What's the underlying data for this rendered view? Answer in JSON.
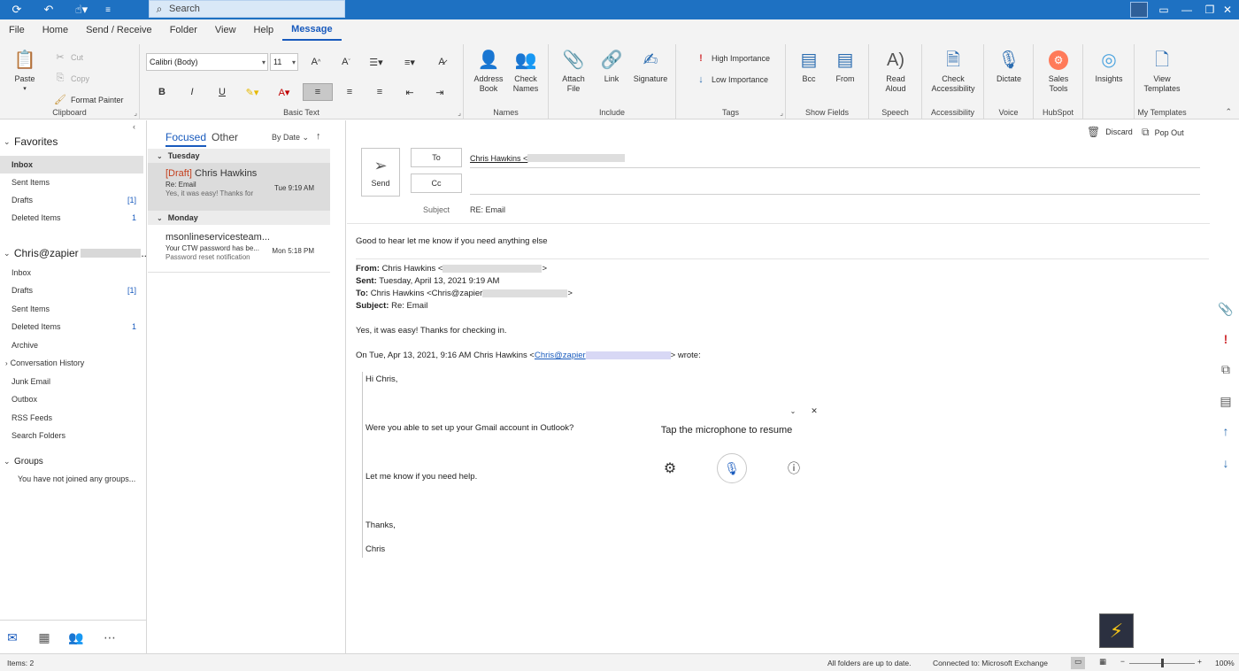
{
  "titlebar": {
    "search_placeholder": "Search"
  },
  "menu_tabs": [
    "File",
    "Home",
    "Send / Receive",
    "Folder",
    "View",
    "Help",
    "Message"
  ],
  "ribbon": {
    "clipboard": {
      "paste": "Paste",
      "cut": "Cut",
      "copy": "Copy",
      "format_painter": "Format Painter",
      "label": "Clipboard"
    },
    "basic_text": {
      "font": "Calibri (Body)",
      "size": "11",
      "label": "Basic Text"
    },
    "names": {
      "address_book": "Address Book",
      "check_names": "Check Names",
      "label": "Names"
    },
    "include": {
      "attach_file": "Attach File",
      "link": "Link",
      "signature": "Signature",
      "label": "Include"
    },
    "tags": {
      "high": "High Importance",
      "low": "Low Importance",
      "label": "Tags"
    },
    "show_fields": {
      "bcc": "Bcc",
      "from": "From",
      "label": "Show Fields"
    },
    "speech": {
      "read_aloud": "Read Aloud",
      "label": "Speech"
    },
    "accessibility": {
      "check": "Check Accessibility",
      "label": "Accessibility"
    },
    "voice": {
      "dictate": "Dictate",
      "label": "Voice"
    },
    "hubspot": {
      "sales_tools": "Sales Tools",
      "label": "HubSpot"
    },
    "insights": {
      "label": "Insights"
    },
    "templates": {
      "view": "View Templates",
      "label": "My Templates"
    }
  },
  "folders": {
    "favorites_header": "Favorites",
    "favorites": [
      {
        "label": "Inbox",
        "count": ""
      },
      {
        "label": "Sent Items",
        "count": ""
      },
      {
        "label": "Drafts",
        "count": "[1]"
      },
      {
        "label": "Deleted Items",
        "count": "1"
      }
    ],
    "account_header": "Chris@zapier",
    "account_suffix": "..",
    "account": [
      {
        "label": "Inbox",
        "count": ""
      },
      {
        "label": "Drafts",
        "count": "[1]"
      },
      {
        "label": "Sent Items",
        "count": ""
      },
      {
        "label": "Deleted Items",
        "count": "1"
      },
      {
        "label": "Archive",
        "count": ""
      },
      {
        "label": "Conversation History",
        "count": ""
      },
      {
        "label": "Junk Email",
        "count": ""
      },
      {
        "label": "Outbox",
        "count": ""
      },
      {
        "label": "RSS Feeds",
        "count": ""
      },
      {
        "label": "Search Folders",
        "count": ""
      }
    ],
    "groups_header": "Groups",
    "groups_empty": "You have not joined any groups..."
  },
  "message_list": {
    "tab_focused": "Focused",
    "tab_other": "Other",
    "sort": "By Date",
    "groups": [
      {
        "label": "Tuesday"
      },
      {
        "label": "Monday"
      }
    ],
    "items": [
      {
        "draft": "[Draft]",
        "from": "Chris Hawkins",
        "subject": "Re: Email",
        "preview": "Yes, it was easy! Thanks for",
        "time": "Tue 9:19 AM"
      },
      {
        "draft": "",
        "from": "msonlineservicesteam...",
        "subject": "Your CTW password has be...",
        "preview": "Password reset notification",
        "time": "Mon 5:18 PM"
      }
    ]
  },
  "reading": {
    "discard": "Discard",
    "pop_out": "Pop Out",
    "send": "Send",
    "to_label": "To",
    "cc_label": "Cc",
    "to_value": "Chris Hawkins <",
    "subject_label": "Subject",
    "subject_value": "RE: Email",
    "line1": "Good to hear let me know if you need anything else",
    "from_label": "From:",
    "from_value": "Chris Hawkins <",
    "sent_label": "Sent:",
    "sent_value": "Tuesday, April 13, 2021 9:19 AM",
    "to2_label": "To:",
    "to2_value": "Chris Hawkins <Chris@zapier",
    "subj2_label": "Subject:",
    "subj2_value": "Re: Email",
    "reply": "Yes, it was easy! Thanks for checking in.",
    "wrote_prefix": "On Tue, Apr 13, 2021, 9:16 AM Chris Hawkins <",
    "wrote_link": "Chris@zapier",
    "wrote_suffix": "> wrote:",
    "q1": "Hi Chris,",
    "q2": "Were you able to set up your Gmail account in Outlook?",
    "q3": "Let me know if you need help.",
    "q4": "Thanks,",
    "q5": "Chris",
    "dictate_msg": "Tap the microphone to resume"
  },
  "status": {
    "items": "Items: 2",
    "sync": "All folders are up to date.",
    "connected": "Connected to: Microsoft Exchange",
    "zoom": "100%"
  }
}
